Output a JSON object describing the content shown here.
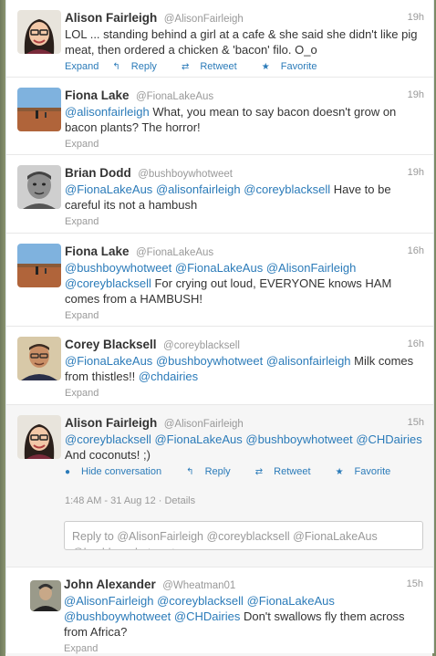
{
  "tweets": [
    {
      "fullname": "Alison Fairleigh",
      "username": "@AlisonFairleigh",
      "time": "19h",
      "segments": [
        {
          "t": "LOL ... standing behind a girl at a cafe & she said she didn't like pig meat, then ordered a chicken & 'bacon' filo. O_o",
          "m": false
        }
      ],
      "actions": [
        "Expand",
        "Reply",
        "Retweet",
        "Favorite"
      ]
    },
    {
      "fullname": "Fiona Lake",
      "username": "@FionaLakeAus",
      "time": "19h",
      "segments": [
        {
          "t": "@alisonfairleigh",
          "m": true
        },
        {
          "t": " What, you mean to say bacon doesn't grow on bacon plants? The horror!",
          "m": false
        }
      ],
      "actions": [
        "Expand"
      ]
    },
    {
      "fullname": "Brian Dodd",
      "username": "@bushboywhotweet",
      "time": "19h",
      "segments": [
        {
          "t": "@FionaLakeAus",
          "m": true
        },
        {
          "t": " ",
          "m": false
        },
        {
          "t": "@alisonfairleigh",
          "m": true
        },
        {
          "t": " ",
          "m": false
        },
        {
          "t": "@coreyblacksell",
          "m": true
        },
        {
          "t": " Have to be careful its not a hambush",
          "m": false
        }
      ],
      "actions": [
        "Expand"
      ]
    },
    {
      "fullname": "Fiona Lake",
      "username": "@FionaLakeAus",
      "time": "16h",
      "segments": [
        {
          "t": "@bushboywhotweet",
          "m": true
        },
        {
          "t": " ",
          "m": false
        },
        {
          "t": "@FionaLakeAus",
          "m": true
        },
        {
          "t": " ",
          "m": false
        },
        {
          "t": "@AlisonFairleigh",
          "m": true
        },
        {
          "t": " ",
          "m": false
        },
        {
          "t": "@coreyblacksell",
          "m": true
        },
        {
          "t": " For crying out loud, EVERYONE knows HAM comes from a HAMBUSH!",
          "m": false
        }
      ],
      "actions": [
        "Expand"
      ]
    },
    {
      "fullname": "Corey Blacksell",
      "username": "@coreyblacksell",
      "time": "16h",
      "segments": [
        {
          "t": "@FionaLakeAus",
          "m": true
        },
        {
          "t": " ",
          "m": false
        },
        {
          "t": "@bushboywhotweet",
          "m": true
        },
        {
          "t": " ",
          "m": false
        },
        {
          "t": "@alisonfairleigh",
          "m": true
        },
        {
          "t": " Milk comes from thistles!! ",
          "m": false
        },
        {
          "t": "@chdairies",
          "m": true
        }
      ],
      "actions": [
        "Expand"
      ]
    },
    {
      "fullname": "Alison Fairleigh",
      "username": "@AlisonFairleigh",
      "time": "15h",
      "segments": [
        {
          "t": "@coreyblacksell",
          "m": true
        },
        {
          "t": " ",
          "m": false
        },
        {
          "t": "@FionaLakeAus",
          "m": true
        },
        {
          "t": " ",
          "m": false
        },
        {
          "t": "@bushboywhotweet",
          "m": true
        },
        {
          "t": " ",
          "m": false
        },
        {
          "t": "@CHDairies",
          "m": true
        },
        {
          "t": " And coconuts! ;)",
          "m": false
        }
      ],
      "actions": [
        "Hide conversation",
        "Reply",
        "Retweet",
        "Favorite"
      ],
      "meta": "1:48 AM - 31 Aug 12 · Details"
    },
    {
      "fullname": "John Alexander",
      "username": "@Wheatman01",
      "time": "15h",
      "segments": [
        {
          "t": "@AlisonFairleigh",
          "m": true
        },
        {
          "t": " ",
          "m": false
        },
        {
          "t": "@coreyblacksell",
          "m": true
        },
        {
          "t": " ",
          "m": false
        },
        {
          "t": "@FionaLakeAus",
          "m": true
        },
        {
          "t": " ",
          "m": false
        },
        {
          "t": "@bushboywhotweet",
          "m": true
        },
        {
          "t": " ",
          "m": false
        },
        {
          "t": "@CHDairies",
          "m": true
        },
        {
          "t": " Don't swallows fly them across from Africa?",
          "m": false
        }
      ],
      "actions": [
        "Expand"
      ]
    }
  ],
  "reply_box": {
    "text": "Reply to @AlisonFairleigh @coreyblacksell @FionaLakeAus @bushboywhotweet"
  },
  "colors": {
    "link": "#2b7bb9",
    "text": "#333333",
    "muted": "#999999"
  }
}
